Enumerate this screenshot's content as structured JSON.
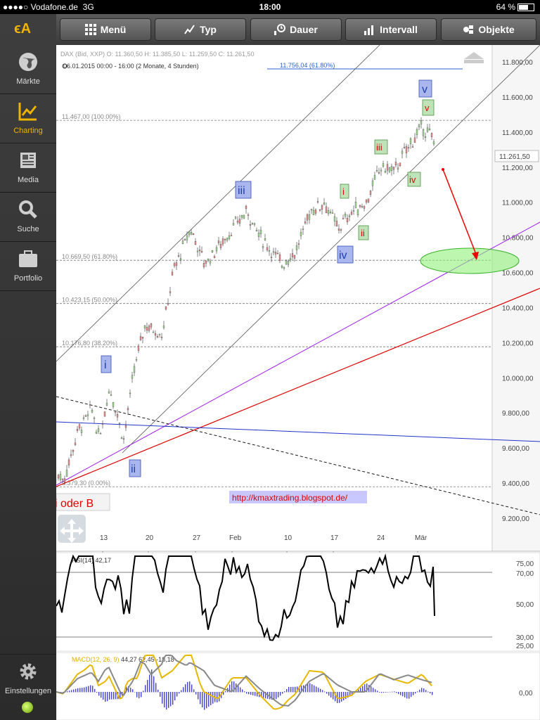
{
  "status": {
    "carrier": "●●●●○ Vodafone.de",
    "network": "3G",
    "time": "18:00",
    "battery": "64 %",
    "battery_level": 0.64
  },
  "sidebar": {
    "logo": "ϵA",
    "items": [
      {
        "label": "Märkte",
        "icon": "globe-icon"
      },
      {
        "label": "Charting",
        "icon": "chart-icon"
      },
      {
        "label": "Media",
        "icon": "newspaper-icon"
      },
      {
        "label": "Suche",
        "icon": "search-icon"
      },
      {
        "label": "Portfolio",
        "icon": "briefcase-icon"
      }
    ],
    "settings_label": "Einstellungen"
  },
  "toolbar": {
    "buttons": [
      {
        "label": "Menü",
        "icon": "grid-icon"
      },
      {
        "label": "Typ",
        "icon": "line-chart-icon"
      },
      {
        "label": "Dauer",
        "icon": "clock-icon"
      },
      {
        "label": "Intervall",
        "icon": "bars-icon"
      },
      {
        "label": "Objekte",
        "icon": "objects-icon"
      }
    ]
  },
  "chart": {
    "header": "DAX (Bid, XXP)  O: 11.360,50  H: 11.385,50  L: 11.259,50  C: 11.261,50",
    "period": "06.01.2015 00:00 - 16:00 (2 Monate, 4 Stunden)",
    "price_ticks": [
      "11.800,00",
      "11.600,00",
      "11.400,00",
      "11.200,00",
      "11.000,00",
      "10.800,00",
      "10.600,00",
      "10.400,00",
      "10.200,00",
      "10.000,00",
      "9.800,00",
      "9.600,00",
      "9.400,00",
      "9.200,00"
    ],
    "last_price": "11.261,50",
    "date_ticks": [
      "13",
      "20",
      "27",
      "Feb",
      "10",
      "17",
      "24",
      "Mär"
    ],
    "fib_levels": [
      {
        "label": "11.467,00 (100.00%)",
        "value": 11467
      },
      {
        "label": "10.669,50 (61.80%)",
        "value": 10669.5
      },
      {
        "label": "10.423,15 (50.00%)",
        "value": 10423.15
      },
      {
        "label": "10.176,80 (38.20%)",
        "value": 10176.8
      },
      {
        "label": "9.379,30 (0.00%)",
        "value": 9379.3
      }
    ],
    "fib_ext": "11.756,04 (61.80%)",
    "waves_blue": [
      "i",
      "ii",
      "iii",
      "iv",
      "v"
    ],
    "waves_green": [
      "i",
      "ii",
      "iii",
      "iv",
      "v"
    ],
    "note": "i oder B",
    "url": "http://kmaxtrading.blogspot.de/",
    "rsi": {
      "label": "RSI(14)",
      "value": "42,17",
      "ticks": [
        "75,00",
        "70,00",
        "50,00",
        "30,00",
        "25,00"
      ]
    },
    "macd": {
      "label": "MACD(12, 26, 9)",
      "values": "44,27  62,45  -18,18",
      "ticks": [
        "0,00"
      ]
    }
  }
}
